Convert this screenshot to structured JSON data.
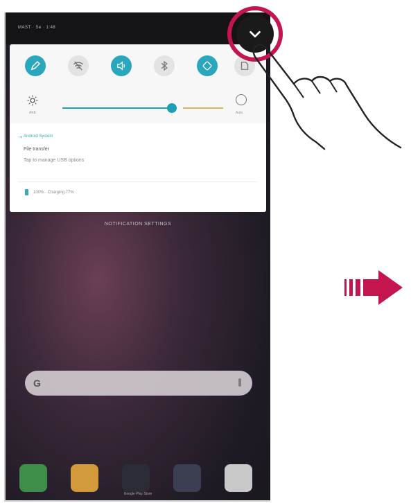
{
  "status": {
    "text": "MAST · Se · 1:48"
  },
  "quick_settings": {
    "toggles": [
      {
        "name": "edit-icon",
        "on": true
      },
      {
        "name": "wifi-off-icon",
        "on": false
      },
      {
        "name": "sound-icon",
        "on": true
      },
      {
        "name": "bluetooth-off-icon",
        "on": false
      },
      {
        "name": "rotate-icon",
        "on": true
      },
      {
        "name": "nfc-icon",
        "on": false
      }
    ],
    "brightness_left_label": "AKE",
    "brightness_right_label": "Auto",
    "brightness_level": 0.68
  },
  "notification": {
    "app": "Android System",
    "title": "File transfer",
    "text": "Tap to manage USB options",
    "footer": "100% · Charging 77% ·"
  },
  "clear_label": "NOTIFICATION SETTINGS",
  "search": {
    "logo": "G"
  },
  "dock": {
    "apps": [
      {
        "name": "phone-app-icon",
        "color": "#3e8d4b"
      },
      {
        "name": "notes-app-icon",
        "color": "#d29a3a"
      },
      {
        "name": "camera-app-icon",
        "color": "#2c2c36"
      },
      {
        "name": "play-store-app-icon",
        "color": "#3c3f52"
      },
      {
        "name": "chrome-app-icon",
        "color": "#c8c8c8"
      }
    ],
    "pager_label": "Google Play Store"
  },
  "colors": {
    "accent": "#2aa7bd",
    "highlight_ring": "#c4154f",
    "arrow": "#c4154f"
  }
}
